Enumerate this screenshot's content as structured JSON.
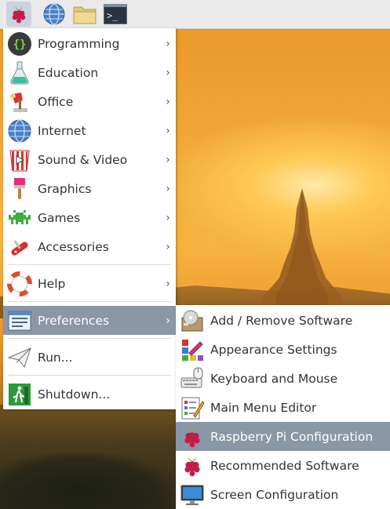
{
  "taskbar": {
    "buttons": [
      {
        "icon": "raspberry-icon",
        "active": true
      },
      {
        "icon": "globe-icon"
      },
      {
        "icon": "folder-icon"
      },
      {
        "icon": "terminal-icon",
        "glyph": ">_"
      }
    ]
  },
  "main_menu": {
    "items": [
      {
        "label": "Programming",
        "icon": "programming-icon",
        "has_submenu": true
      },
      {
        "label": "Education",
        "icon": "education-icon",
        "has_submenu": true
      },
      {
        "label": "Office",
        "icon": "office-icon",
        "has_submenu": true
      },
      {
        "label": "Internet",
        "icon": "internet-icon",
        "has_submenu": true
      },
      {
        "label": "Sound & Video",
        "icon": "sound-video-icon",
        "has_submenu": true
      },
      {
        "label": "Graphics",
        "icon": "graphics-icon",
        "has_submenu": true
      },
      {
        "label": "Games",
        "icon": "games-icon",
        "has_submenu": true
      },
      {
        "label": "Accessories",
        "icon": "accessories-icon",
        "has_submenu": true
      },
      {
        "label": "Help",
        "icon": "help-icon",
        "has_submenu": true
      },
      {
        "label": "Preferences",
        "icon": "preferences-icon",
        "has_submenu": true,
        "highlighted": true
      },
      {
        "label": "Run...",
        "icon": "run-icon"
      },
      {
        "label": "Shutdown...",
        "icon": "shutdown-icon"
      }
    ],
    "arrow": "›"
  },
  "preferences_submenu": {
    "items": [
      {
        "label": "Add / Remove Software",
        "icon": "add-remove-software-icon"
      },
      {
        "label": "Appearance Settings",
        "icon": "appearance-settings-icon"
      },
      {
        "label": "Keyboard and Mouse",
        "icon": "keyboard-mouse-icon"
      },
      {
        "label": "Main Menu Editor",
        "icon": "main-menu-editor-icon"
      },
      {
        "label": "Raspberry Pi Configuration",
        "icon": "raspberry-icon",
        "highlighted": true
      },
      {
        "label": "Recommended Software",
        "icon": "raspberry-icon"
      },
      {
        "label": "Screen Configuration",
        "icon": "screen-configuration-icon"
      }
    ]
  },
  "colors": {
    "highlight": "#8a97a7",
    "menu_bg": "#ffffff",
    "taskbar_bg": "#eaeaea",
    "text": "#333333",
    "raspberry_red": "#c51a4a",
    "leaf_green": "#6cc04a"
  }
}
